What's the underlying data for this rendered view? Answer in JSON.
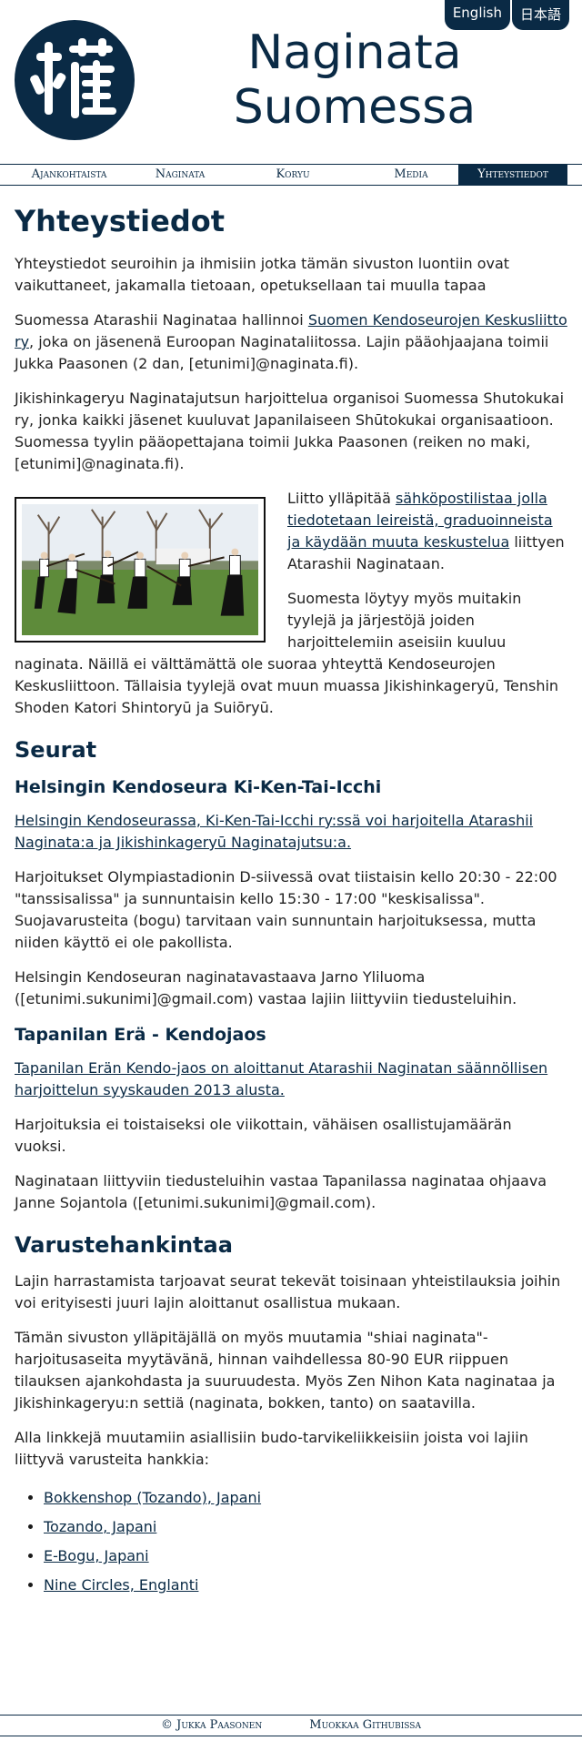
{
  "lang": {
    "english": "English",
    "japanese": "日本語"
  },
  "header": {
    "title_line1": "Naginata",
    "title_line2": "Suomessa",
    "logo_icon": "kanji-logo-icon"
  },
  "nav": {
    "items": [
      "Ajankohtaista",
      "Naginata",
      "Koryu",
      "Media",
      "Yhteystiedot"
    ],
    "active": "Yhteystiedot"
  },
  "main": {
    "title": "Yhteystiedot",
    "intro": "Yhteystiedot seuroihin ja ihmisiin jotka tämän sivuston luontiin ovat vaikuttaneet, jakamalla tietoaan, opetuksellaan tai muulla tapaa",
    "p2_a": "Suomessa Atarashii Naginataa hallinnoi ",
    "p2_link": "Suomen Kendoseurojen Keskusliitto ry",
    "p2_b": ", joka on jäsenenä Euroopan Naginataliitossa. Lajin pääohjaajana toimii Jukka Paasonen (2 dan, [etunimi]@naginata.fi).",
    "p3": "Jikishinkageryu Naginatajutsun harjoittelua organisoi Suomessa Shutokukai ry, jonka kaikki jäsenet kuuluvat Japanilaiseen Shūtokukai organisaatioon. Suomessa tyylin pääopettajana toimii Jukka Paasonen (reiken no maki, [etunimi]@naginata.fi).",
    "p4_a": "Liitto ylläpitää ",
    "p4_link": "sähköpostilistaa jolla tiedotetaan leireistä, graduoinneista ja käydään muuta keskustelua",
    "p4_b": " liittyen Atarashii Naginataan.",
    "p5": "Suomesta löytyy myös muitakin tyylejä ja järjestöjä joiden harjoittelemiin aseisiin kuuluu naginata. Näillä ei välttämättä ole suoraa yhteyttä Kendoseurojen Keskusliittoon. Tällaisia tyylejä ovat muun muassa Jikishinkageryū, Tenshin Shoden Katori Shintoryū ja Suiōryū."
  },
  "clubs": {
    "title": "Seurat",
    "club1": {
      "name": "Helsingin Kendoseura Ki-Ken-Tai-Icchi",
      "link": "Helsingin Kendoseurassa, Ki-Ken-Tai-Icchi ry:ssä voi harjoitella Atarashii Naginata:a ja Jikishinkageryū Naginatajutsu:a.",
      "p1": "Harjoitukset Olympiastadionin D-siivessä ovat tiistaisin kello 20:30 - 22:00 \"tanssisalissa\" ja sunnuntaisin kello 15:30 - 17:00 \"keskisalissa\". Suojavarusteita (bogu) tarvitaan vain sunnuntain harjoituksessa, mutta niiden käyttö ei ole pakollista.",
      "p2": "Helsingin Kendoseuran naginatavastaava Jarno Yliluoma ([etunimi.sukunimi]@gmail.com) vastaa lajiin liittyviin tiedusteluihin."
    },
    "club2": {
      "name": "Tapanilan Erä - Kendojaos",
      "link": "Tapanilan Erän Kendo-jaos on aloittanut Atarashii Naginatan säännöllisen harjoittelun syyskauden 2013 alusta.",
      "p1": "Harjoituksia ei toistaiseksi ole viikottain, vähäisen osallistujamäärän vuoksi.",
      "p2": "Naginataan liittyviin tiedusteluihin vastaa Tapanilassa naginataa ohjaava Janne Sojantola ([etunimi.sukunimi]@gmail.com)."
    }
  },
  "gear": {
    "title": "Varustehankintaa",
    "p1": "Lajin harrastamista tarjoavat seurat tekevät toisinaan yhteistilauksia joihin voi erityisesti juuri lajin aloittanut osallistua mukaan.",
    "p2": "Tämän sivuston ylläpitäjällä on myös muutamia \"shiai naginata\"-harjoitusaseita myytävänä, hinnan vaihdellessa 80-90 EUR riippuen tilauksen ajankohdasta ja suuruudesta. Myös Zen Nihon Kata naginataa ja Jikishinkageryu:n settiä (naginata, bokken, tanto) on saatavilla.",
    "p3": "Alla linkkejä muutamiin asiallisiin budo-tarvikeliikkeisiin joista voi lajiin liittyvä varusteita hankkia:",
    "shops": [
      "Bokkenshop (Tozando), Japani",
      "Tozando, Japani",
      "E-Bogu, Japani",
      "Nine Circles, Englanti"
    ]
  },
  "footer": {
    "author": "© Jukka Paasonen",
    "edit": "Muokkaa Githubissa"
  }
}
